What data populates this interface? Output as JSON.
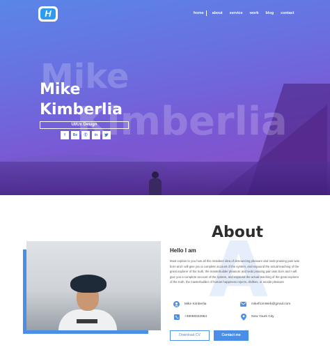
{
  "brand": {
    "logo_letter": "H",
    "accent": "#4a8ee8"
  },
  "nav": {
    "items": [
      "home",
      "about",
      "service",
      "work",
      "blog",
      "contact"
    ]
  },
  "hero": {
    "bg_words": [
      "Mike",
      "Kimberlia"
    ],
    "first_name": "Mike",
    "last_name": "Kimberlia",
    "role": "UI/Ux Design",
    "socials": [
      "f",
      "Be",
      "Ⓔ",
      "in",
      "𝕏"
    ]
  },
  "about": {
    "title": "About",
    "bg_letter": "A",
    "hello": "Hello I am",
    "bio": "Must explain to you how all this mistaken idea of denouncing pleasure and seds praising pain was born and I will give you a complete account of the system, and expound the actual teaching of the great explorer of the truth, the masterbuilder pleasure and seds praising pain was born and I will give you a complete account of the system, and expound the actual teaching of the great explorer of the truth, the masterbuilder of human happiness rejects, dislikes, or avoids pleasure",
    "info": {
      "name": "Mike Kimberlia",
      "email": "mikefromWeb@gmail.com",
      "phone": "+38098332984",
      "location": "New Yourk City"
    },
    "buttons": {
      "download": "Download CV",
      "contact": "Contact me"
    }
  }
}
